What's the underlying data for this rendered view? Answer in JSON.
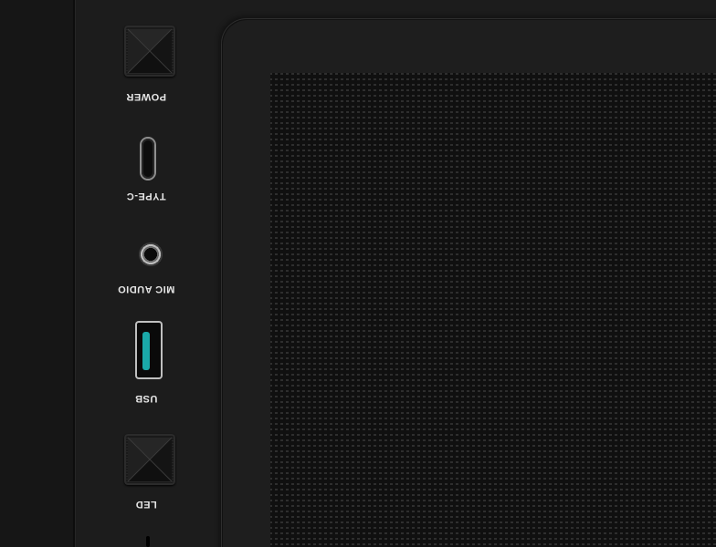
{
  "io_panel": {
    "power_label": "POWER",
    "typec_label": "TYPE-C",
    "audio_label": "MIC AUDIO",
    "usb_label": "USB",
    "led_label": "LED"
  },
  "colors": {
    "background": "#1c1c1c",
    "usb_tongue": "#1aa8a8",
    "label_text": "#e6e6e6"
  },
  "icons": {
    "power_button": "square-pyramid-button",
    "led_button": "square-pyramid-button"
  }
}
